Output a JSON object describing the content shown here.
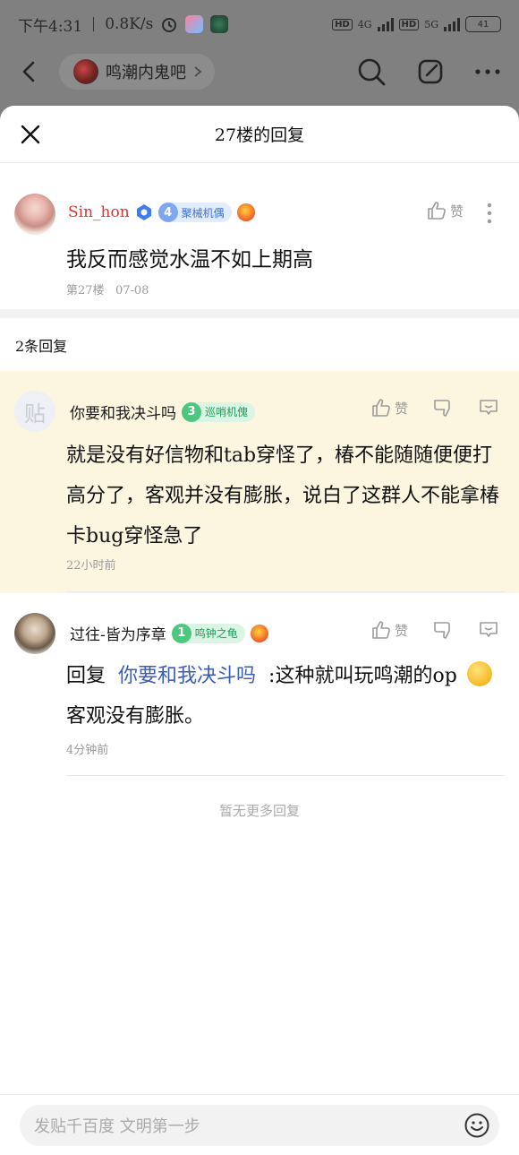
{
  "status_bar": {
    "time": "下午4:31",
    "net_speed": "0.8K/s",
    "hd1": "HD",
    "sig1": "4G",
    "hd2": "HD",
    "sig2": "5G",
    "battery": "41"
  },
  "nav": {
    "forum_name": "鸣潮内鬼吧"
  },
  "sheet": {
    "title": "27楼的回复"
  },
  "main_post": {
    "username": "Sin_hon",
    "level": "4",
    "level_title": "聚械机偶",
    "like_label": "赞",
    "content": "我反而感觉水温不如上期高",
    "floor": "第27楼",
    "date": "07-08"
  },
  "reply_count": "2条回复",
  "replies": [
    {
      "username": "你要和我决斗吗",
      "level": "3",
      "level_title": "巡哨机傀",
      "like_label": "赞",
      "content": "就是没有好信物和tab穿怪了，椿不能随随便便打高分了，客观并没有膨胀，说白了这群人不能拿椿卡bug穿怪急了",
      "time": "22小时前"
    },
    {
      "username": "过往-皆为序章",
      "level": "1",
      "level_title": "鸣钟之龟",
      "like_label": "赞",
      "reply_prefix": "回复",
      "reply_to": "你要和我决斗吗",
      "content_before": ":这种就叫玩鸣潮的op",
      "content_after": "客观没有膨胀。",
      "time": "4分钟前"
    }
  ],
  "no_more": "暂无更多回复",
  "input": {
    "placeholder": "发贴千百度 文明第一步"
  },
  "colors": {
    "accent_name": "#e0312e",
    "mention": "#3b5db7",
    "highlight_bg": "#fcf6e1"
  }
}
